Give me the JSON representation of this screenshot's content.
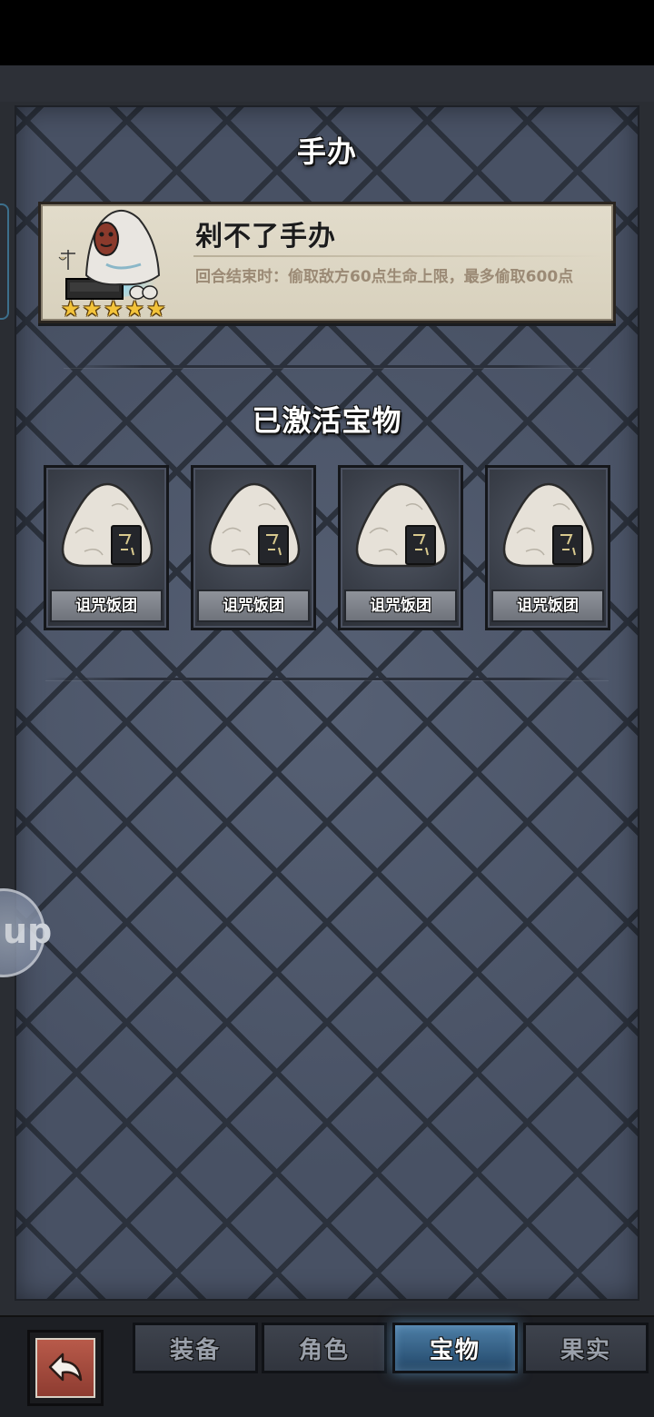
{
  "header": {
    "title": "手办"
  },
  "figure": {
    "name": "剁不了手办",
    "description": "回合结束时：偷取敌方60点生命上限，最多偷取600点",
    "stars": [
      "★",
      "★",
      "★",
      "★",
      "★"
    ],
    "star_count": 5
  },
  "activated": {
    "title": "已激活宝物",
    "items": [
      {
        "label": "诅咒饭团",
        "icon": "rice-ball-icon"
      },
      {
        "label": "诅咒饭团",
        "icon": "rice-ball-icon"
      },
      {
        "label": "诅咒饭团",
        "icon": "rice-ball-icon"
      },
      {
        "label": "诅咒饭团",
        "icon": "rice-ball-icon"
      }
    ]
  },
  "floating_badge": {
    "text": "up"
  },
  "nav": {
    "back_icon": "back-arrow-icon",
    "tabs": [
      {
        "label": "装备",
        "active": false
      },
      {
        "label": "角色",
        "active": false
      },
      {
        "label": "宝物",
        "active": true
      },
      {
        "label": "果实",
        "active": false
      }
    ]
  },
  "colors": {
    "active_tab": "#2f587c",
    "card_bg": "#d8d1bd",
    "star": "#f3c33a",
    "desc_text": "#9b8a75"
  }
}
